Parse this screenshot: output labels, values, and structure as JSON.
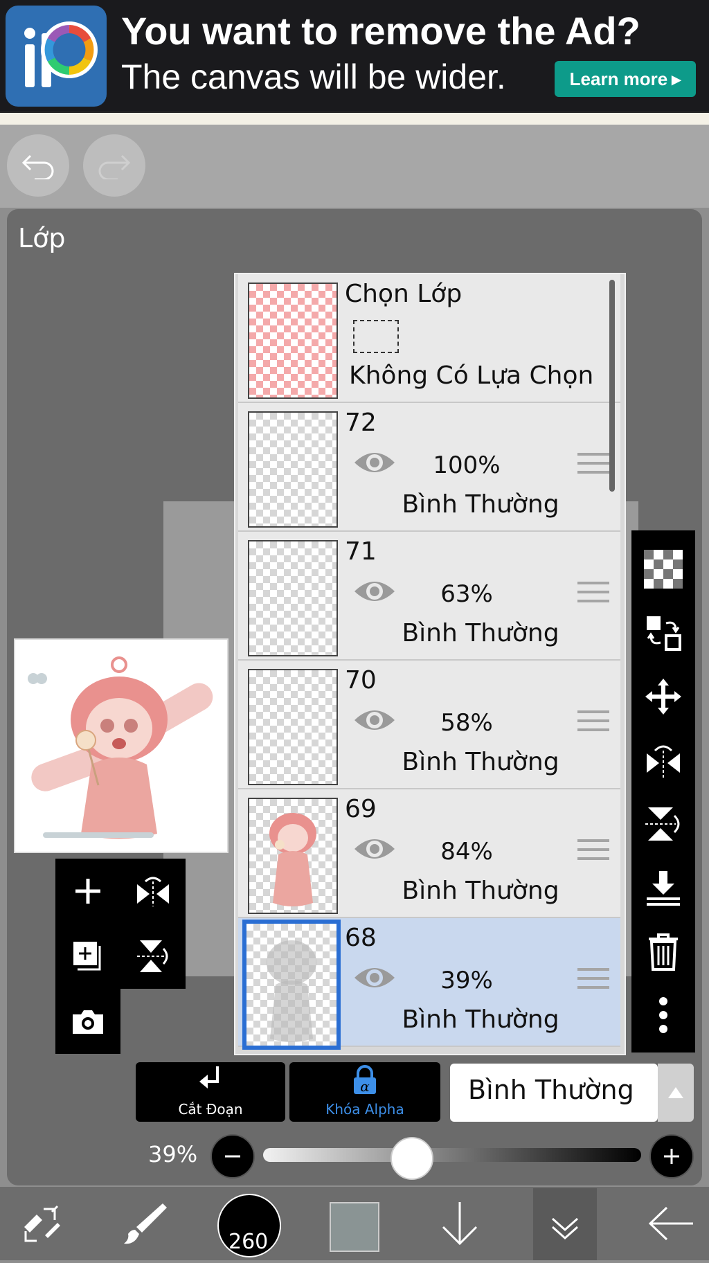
{
  "ad": {
    "title": "You want to remove the Ad?",
    "subtitle": "The canvas will be wider.",
    "cta": "Learn more"
  },
  "panel": {
    "title": "Lớp"
  },
  "selection_layer": {
    "name": "Chọn Lớp",
    "status": "Không Có Lựa Chọn"
  },
  "layers": [
    {
      "name": "72",
      "opacity": "100%",
      "mode": "Bình Thường",
      "selected": false
    },
    {
      "name": "71",
      "opacity": "63%",
      "mode": "Bình Thường",
      "selected": false
    },
    {
      "name": "70",
      "opacity": "58%",
      "mode": "Bình Thường",
      "selected": false
    },
    {
      "name": "69",
      "opacity": "84%",
      "mode": "Bình Thường",
      "selected": false
    },
    {
      "name": "68",
      "opacity": "39%",
      "mode": "Bình Thường",
      "selected": true
    }
  ],
  "controls": {
    "clipping_label": "Cắt Đoạn",
    "alpha_lock_label": "Khóa Alpha",
    "blend_mode": "Bình Thường",
    "opacity_display": "39%",
    "opacity_value": 0.39
  },
  "bottom_bar": {
    "brush_size": "260",
    "color": "#8a9494"
  },
  "colors": {
    "selected_row": "#c9d8ee",
    "accent_blue": "#2a6ed3",
    "alpha_blue": "#3d8fe8",
    "ad_button": "#0d9b8a"
  }
}
